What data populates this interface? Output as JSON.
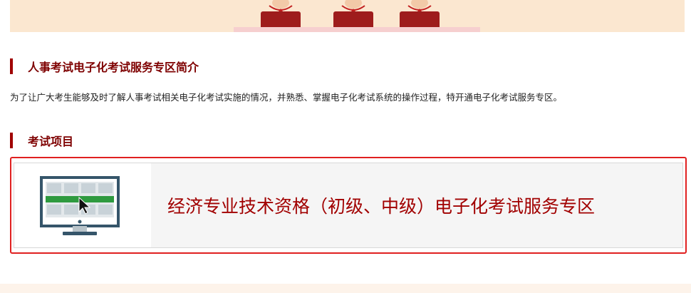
{
  "intro_section": {
    "title": "人事考试电子化考试服务专区简介",
    "body": "为了让广大考生能够及时了解人事考试相关电子化考试实施的情况，并熟悉、掌握电子化考试系统的操作过程，特开通电子化考试服务专区。"
  },
  "projects_section": {
    "title": "考试项目",
    "items": [
      {
        "label": "经济专业技术资格（初级、中级）电子化考试服务专区",
        "icon": "computer-monitor-icon"
      }
    ]
  },
  "colors": {
    "accent": "#a00000",
    "card_border": "#e02020",
    "banner_bg": "#fbe7d0"
  }
}
